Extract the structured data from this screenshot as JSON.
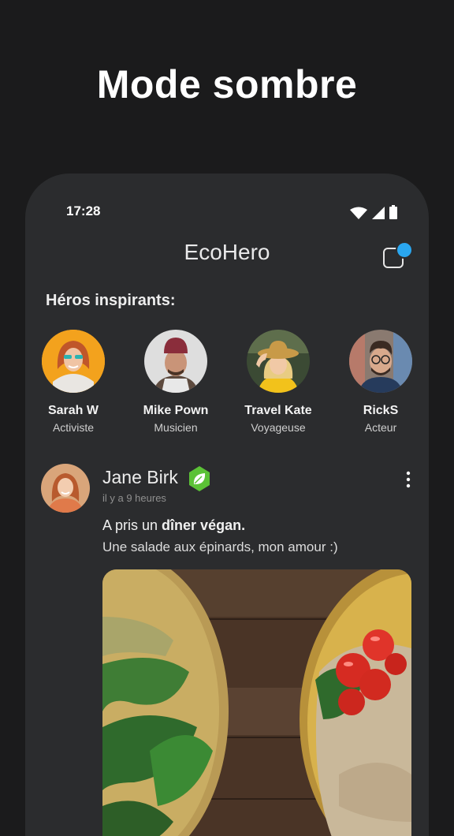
{
  "headline": "Mode sombre",
  "status_bar": {
    "time": "17:28"
  },
  "app": {
    "title": "EcoHero"
  },
  "section_title": "Héros inspirants:",
  "heroes": [
    {
      "name": "Sarah W",
      "role": "Activiste"
    },
    {
      "name": "Mike Pown",
      "role": "Musicien"
    },
    {
      "name": "Travel Kate",
      "role": "Voyageuse"
    },
    {
      "name": "RickS",
      "role": "Acteur"
    }
  ],
  "post": {
    "author": "Jane Birk",
    "time": "il y a 9 heures",
    "text_prefix": "A pris un ",
    "text_bold": "dîner végan.",
    "text_line2": "Une salade aux épinards, mon amour :)"
  },
  "colors": {
    "background": "#1b1b1c",
    "card": "#2b2c2e",
    "accent_blue": "#2aa7f0",
    "badge_green": "#5bc236"
  },
  "icons": [
    "wifi-icon",
    "signal-icon",
    "battery-icon",
    "compose-icon",
    "leaf-badge-icon",
    "more-vertical-icon"
  ]
}
